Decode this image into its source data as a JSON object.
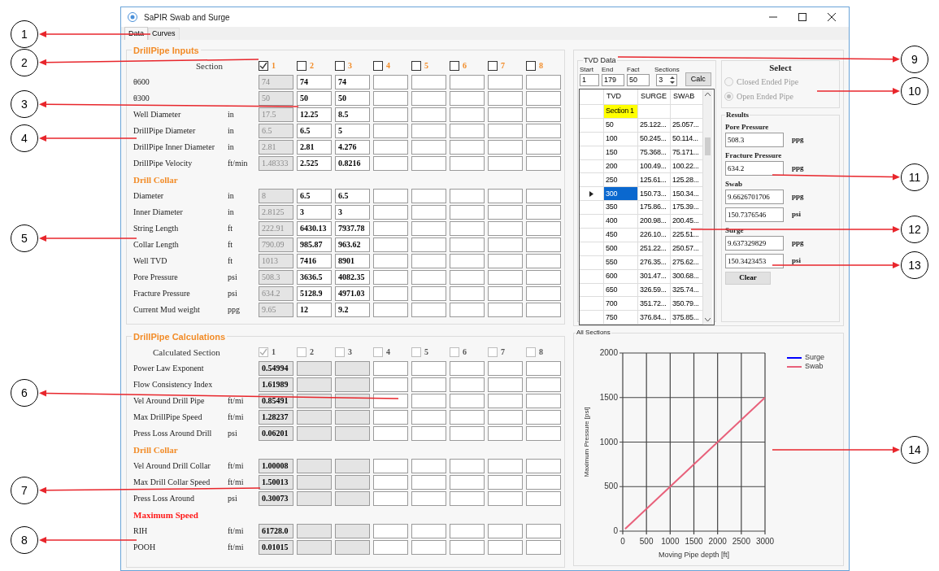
{
  "window": {
    "title": "SaPIR Swab and Surge"
  },
  "tabs": [
    {
      "label": "Data",
      "selected": true
    },
    {
      "label": "Curves",
      "selected": false
    }
  ],
  "inputs": {
    "title": "DrillPipe Inputs",
    "header_label": "Section",
    "sections": [
      {
        "label": "1",
        "checked": true,
        "disabled": true
      },
      {
        "label": "2",
        "checked": false,
        "disabled": false
      },
      {
        "label": "3",
        "checked": false,
        "disabled": false
      },
      {
        "label": "4",
        "checked": false,
        "disabled": false
      },
      {
        "label": "5",
        "checked": false,
        "disabled": false
      },
      {
        "label": "6",
        "checked": false,
        "disabled": false
      },
      {
        "label": "7",
        "checked": false,
        "disabled": false
      },
      {
        "label": "8",
        "checked": false,
        "disabled": false
      }
    ],
    "groups": [
      {
        "rows": [
          {
            "label": "θ600",
            "values": [
              "74",
              "74",
              "74"
            ]
          },
          {
            "label": "θ300",
            "values": [
              "50",
              "50",
              "50"
            ]
          },
          {
            "label": "Well Diameter",
            "unit": "in",
            "values": [
              "17.5",
              "12.25",
              "8.5"
            ]
          },
          {
            "label": "DrillPipe Diameter",
            "unit": "in",
            "values": [
              "6.5",
              "6.5",
              "5"
            ]
          },
          {
            "label": "DrillPipe Inner Diameter",
            "unit": "in",
            "values": [
              "2.81",
              "2.81",
              "4.276"
            ]
          },
          {
            "label": "DrillPipe Velocity",
            "unit": "ft/min",
            "values": [
              "1.48333",
              "2.525",
              "0.8216"
            ]
          }
        ]
      },
      {
        "heading": "Drill Collar",
        "color": "#f28c28",
        "rows": [
          {
            "label": "Diameter",
            "unit": "in",
            "values": [
              "8",
              "6.5",
              "6.5"
            ]
          },
          {
            "label": "Inner Diameter",
            "unit": "in",
            "values": [
              "2.8125",
              "3",
              "3"
            ]
          },
          {
            "label": "String Length",
            "unit": "ft",
            "values": [
              "222.91",
              "6430.13",
              "7937.78"
            ]
          },
          {
            "label": "Collar Length",
            "unit": "ft",
            "values": [
              "790.09",
              "985.87",
              "963.62"
            ]
          },
          {
            "label": "Well TVD",
            "unit": "ft",
            "values": [
              "1013",
              "7416",
              "8901"
            ]
          },
          {
            "label": "Pore Pressure",
            "unit": "psi",
            "values": [
              "508.3",
              "3636.5",
              "4082.35"
            ]
          },
          {
            "label": "Fracture Pressure",
            "unit": "psi",
            "values": [
              "634.2",
              "5128.9",
              "4971.03"
            ]
          },
          {
            "label": "Current Mud weight",
            "unit": "ppg",
            "values": [
              "9.65",
              "12",
              "9.2"
            ]
          }
        ]
      }
    ]
  },
  "calc": {
    "title": "DrillPipe Calculations",
    "header_label": "Calculated Section",
    "sections": [
      {
        "label": "1",
        "checked": true,
        "disabled": true
      },
      {
        "label": "2",
        "checked": false,
        "disabled": true
      },
      {
        "label": "3",
        "checked": false,
        "disabled": true
      },
      {
        "label": "4",
        "checked": false,
        "disabled": false
      },
      {
        "label": "5",
        "checked": false,
        "disabled": false
      },
      {
        "label": "6",
        "checked": false,
        "disabled": false
      },
      {
        "label": "7",
        "checked": false,
        "disabled": false
      },
      {
        "label": "8",
        "checked": false,
        "disabled": false
      }
    ],
    "groups": [
      {
        "rows": [
          {
            "label": "Power Law Exponent",
            "values": [
              "0.54994"
            ]
          },
          {
            "label": "Flow Consistency Index",
            "values": [
              "1.61989"
            ]
          },
          {
            "label": "Vel Around Drill Pipe",
            "unit": "ft/mi",
            "values": [
              "0.85491"
            ]
          },
          {
            "label": "Max DrillPipe Speed",
            "unit": "ft/mi",
            "values": [
              "1.28237"
            ]
          },
          {
            "label": "Press Loss Around Drill",
            "unit": "psi",
            "values": [
              "0.06201"
            ]
          }
        ]
      },
      {
        "heading": "Drill Collar",
        "color": "#f28c28",
        "rows": [
          {
            "label": "Vel Around Drill Collar",
            "unit": "ft/mi",
            "values": [
              "1.00008"
            ]
          },
          {
            "label": "Max Drill Collar Speed",
            "unit": "ft/mi",
            "values": [
              "1.50013"
            ]
          },
          {
            "label": "Press Loss Around",
            "unit": "psi",
            "values": [
              "0.30073"
            ]
          }
        ]
      },
      {
        "heading": "Maximum Speed",
        "color": "#ff1a1a",
        "rows": [
          {
            "label": "RIH",
            "unit": "ft/mi",
            "values": [
              "61728.0"
            ]
          },
          {
            "label": "POOH",
            "unit": "ft/mi",
            "values": [
              "0.01015"
            ]
          }
        ]
      }
    ]
  },
  "tvd": {
    "title": "TVD Data",
    "fields": [
      {
        "label": "Start",
        "value": "1"
      },
      {
        "label": "End",
        "value": "179"
      },
      {
        "label": "Fact",
        "value": "50"
      }
    ],
    "sections": {
      "label": "Sections",
      "value": "3"
    },
    "calc_button": "Calc",
    "grid": {
      "columns": [
        "TVD",
        "SURGE",
        "SWAB"
      ],
      "rows": [
        {
          "kind": "section",
          "cells": [
            "Section 1"
          ],
          "selected": false
        },
        {
          "kind": "data",
          "cells": [
            "50",
            "25.122...",
            "25.057..."
          ],
          "selected": false
        },
        {
          "kind": "data",
          "cells": [
            "100",
            "50.245...",
            "50.114..."
          ],
          "selected": false
        },
        {
          "kind": "data",
          "cells": [
            "150",
            "75.368...",
            "75.171..."
          ],
          "selected": false
        },
        {
          "kind": "data",
          "cells": [
            "200",
            "100.49...",
            "100.22..."
          ],
          "selected": false
        },
        {
          "kind": "data",
          "cells": [
            "250",
            "125.61...",
            "125.28..."
          ],
          "selected": false
        },
        {
          "kind": "data",
          "cells": [
            "300",
            "150.73...",
            "150.34..."
          ],
          "selected": true
        },
        {
          "kind": "data",
          "cells": [
            "350",
            "175.86...",
            "175.39..."
          ],
          "selected": false
        },
        {
          "kind": "data",
          "cells": [
            "400",
            "200.98...",
            "200.45..."
          ],
          "selected": false
        },
        {
          "kind": "data",
          "cells": [
            "450",
            "226.10...",
            "225.51..."
          ],
          "selected": false
        },
        {
          "kind": "data",
          "cells": [
            "500",
            "251.22...",
            "250.57..."
          ],
          "selected": false
        },
        {
          "kind": "data",
          "cells": [
            "550",
            "276.35...",
            "275.62..."
          ],
          "selected": false
        },
        {
          "kind": "data",
          "cells": [
            "600",
            "301.47...",
            "300.68..."
          ],
          "selected": false
        },
        {
          "kind": "data",
          "cells": [
            "650",
            "326.59...",
            "325.74..."
          ],
          "selected": false
        },
        {
          "kind": "data",
          "cells": [
            "700",
            "351.72...",
            "350.79..."
          ],
          "selected": false
        },
        {
          "kind": "data",
          "cells": [
            "750",
            "376.84...",
            "375.85..."
          ],
          "selected": false
        }
      ]
    }
  },
  "select": {
    "title": "Select",
    "options": [
      {
        "label": "Closed Ended Pipe",
        "selected": false,
        "disabled": true
      },
      {
        "label": "Open Ended Pipe",
        "selected": true,
        "disabled": true
      }
    ]
  },
  "results": {
    "title": "Results",
    "items": [
      {
        "label": "Pore Pressure",
        "fields": [
          {
            "value": "508.3",
            "unit": "ppg"
          }
        ]
      },
      {
        "label": "Fracture Pressure",
        "fields": [
          {
            "value": "634.2",
            "unit": "ppg"
          }
        ]
      },
      {
        "label": "Swab",
        "fields": [
          {
            "value": "9.6626701706",
            "unit": "ppg"
          },
          {
            "value": "150.7376546",
            "unit": "psi"
          }
        ]
      },
      {
        "label": "Surge",
        "fields": [
          {
            "value": "9.637329829",
            "unit": "ppg"
          },
          {
            "value": "150.3423453",
            "unit": "psi"
          }
        ]
      }
    ],
    "clear_button": "Clear"
  },
  "chart": {
    "title": "All Sections",
    "chart_data": {
      "type": "line",
      "grid": true,
      "legend": true,
      "xlabel": "Moving Pipe depth [ft]",
      "ylabel": "Maximum Pressure [psi]",
      "x": [
        50,
        3000
      ],
      "series": [
        {
          "name": "Surge",
          "color": "#0000ff",
          "values": [
            null,
            null
          ]
        },
        {
          "name": "Swab",
          "color": "#e8607a",
          "values": [
            25,
            1500
          ]
        }
      ],
      "xlim": [
        0,
        3000
      ],
      "ylim": [
        0,
        2000
      ],
      "xticks": [
        0,
        500,
        1000,
        1500,
        2000,
        2500,
        3000
      ],
      "yticks": [
        0,
        500,
        1000,
        1500,
        2000
      ]
    }
  },
  "callouts": [
    {
      "label": "1"
    },
    {
      "label": "2"
    },
    {
      "label": "3"
    },
    {
      "label": "4"
    },
    {
      "label": "5"
    },
    {
      "label": "6"
    },
    {
      "label": "7"
    },
    {
      "label": "8"
    },
    {
      "label": "9"
    },
    {
      "label": "10"
    },
    {
      "label": "11"
    },
    {
      "label": "12"
    },
    {
      "label": "13"
    },
    {
      "label": "14"
    }
  ]
}
